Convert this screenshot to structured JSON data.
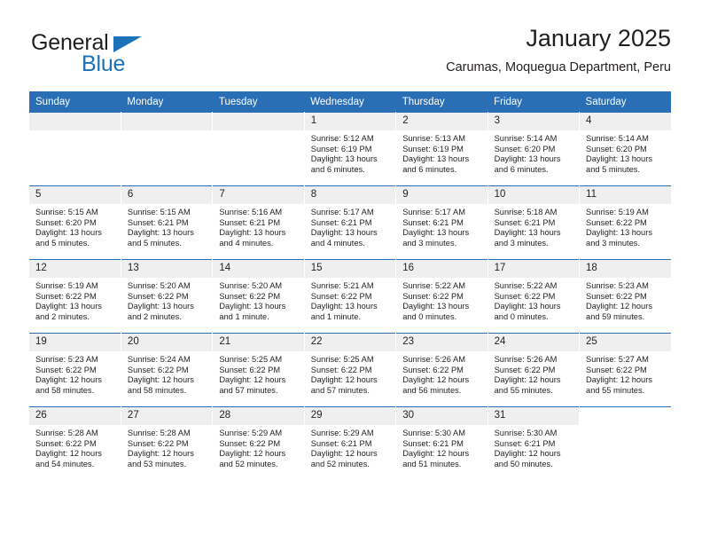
{
  "brand": {
    "name_top": "General",
    "name_bottom": "Blue",
    "accent_color": "#1b72b8"
  },
  "header": {
    "title": "January 2025",
    "subtitle": "Carumas, Moquegua Department, Peru"
  },
  "calendar": {
    "header_bg": "#2a6eb5",
    "daynum_bg": "#efefef",
    "weekdays": [
      "Sunday",
      "Monday",
      "Tuesday",
      "Wednesday",
      "Thursday",
      "Friday",
      "Saturday"
    ],
    "labels": {
      "sunrise": "Sunrise:",
      "sunset": "Sunset:",
      "daylight": "Daylight:"
    },
    "weeks": [
      [
        {
          "day": "",
          "empty": true
        },
        {
          "day": "",
          "empty": true
        },
        {
          "day": "",
          "empty": true
        },
        {
          "day": "1",
          "sunrise": "Sunrise: 5:12 AM",
          "sunset": "Sunset: 6:19 PM",
          "daylight1": "Daylight: 13 hours",
          "daylight2": "and 6 minutes."
        },
        {
          "day": "2",
          "sunrise": "Sunrise: 5:13 AM",
          "sunset": "Sunset: 6:19 PM",
          "daylight1": "Daylight: 13 hours",
          "daylight2": "and 6 minutes."
        },
        {
          "day": "3",
          "sunrise": "Sunrise: 5:14 AM",
          "sunset": "Sunset: 6:20 PM",
          "daylight1": "Daylight: 13 hours",
          "daylight2": "and 6 minutes."
        },
        {
          "day": "4",
          "sunrise": "Sunrise: 5:14 AM",
          "sunset": "Sunset: 6:20 PM",
          "daylight1": "Daylight: 13 hours",
          "daylight2": "and 5 minutes."
        }
      ],
      [
        {
          "day": "5",
          "sunrise": "Sunrise: 5:15 AM",
          "sunset": "Sunset: 6:20 PM",
          "daylight1": "Daylight: 13 hours",
          "daylight2": "and 5 minutes."
        },
        {
          "day": "6",
          "sunrise": "Sunrise: 5:15 AM",
          "sunset": "Sunset: 6:21 PM",
          "daylight1": "Daylight: 13 hours",
          "daylight2": "and 5 minutes."
        },
        {
          "day": "7",
          "sunrise": "Sunrise: 5:16 AM",
          "sunset": "Sunset: 6:21 PM",
          "daylight1": "Daylight: 13 hours",
          "daylight2": "and 4 minutes."
        },
        {
          "day": "8",
          "sunrise": "Sunrise: 5:17 AM",
          "sunset": "Sunset: 6:21 PM",
          "daylight1": "Daylight: 13 hours",
          "daylight2": "and 4 minutes."
        },
        {
          "day": "9",
          "sunrise": "Sunrise: 5:17 AM",
          "sunset": "Sunset: 6:21 PM",
          "daylight1": "Daylight: 13 hours",
          "daylight2": "and 3 minutes."
        },
        {
          "day": "10",
          "sunrise": "Sunrise: 5:18 AM",
          "sunset": "Sunset: 6:21 PM",
          "daylight1": "Daylight: 13 hours",
          "daylight2": "and 3 minutes."
        },
        {
          "day": "11",
          "sunrise": "Sunrise: 5:19 AM",
          "sunset": "Sunset: 6:22 PM",
          "daylight1": "Daylight: 13 hours",
          "daylight2": "and 3 minutes."
        }
      ],
      [
        {
          "day": "12",
          "sunrise": "Sunrise: 5:19 AM",
          "sunset": "Sunset: 6:22 PM",
          "daylight1": "Daylight: 13 hours",
          "daylight2": "and 2 minutes."
        },
        {
          "day": "13",
          "sunrise": "Sunrise: 5:20 AM",
          "sunset": "Sunset: 6:22 PM",
          "daylight1": "Daylight: 13 hours",
          "daylight2": "and 2 minutes."
        },
        {
          "day": "14",
          "sunrise": "Sunrise: 5:20 AM",
          "sunset": "Sunset: 6:22 PM",
          "daylight1": "Daylight: 13 hours",
          "daylight2": "and 1 minute."
        },
        {
          "day": "15",
          "sunrise": "Sunrise: 5:21 AM",
          "sunset": "Sunset: 6:22 PM",
          "daylight1": "Daylight: 13 hours",
          "daylight2": "and 1 minute."
        },
        {
          "day": "16",
          "sunrise": "Sunrise: 5:22 AM",
          "sunset": "Sunset: 6:22 PM",
          "daylight1": "Daylight: 13 hours",
          "daylight2": "and 0 minutes."
        },
        {
          "day": "17",
          "sunrise": "Sunrise: 5:22 AM",
          "sunset": "Sunset: 6:22 PM",
          "daylight1": "Daylight: 13 hours",
          "daylight2": "and 0 minutes."
        },
        {
          "day": "18",
          "sunrise": "Sunrise: 5:23 AM",
          "sunset": "Sunset: 6:22 PM",
          "daylight1": "Daylight: 12 hours",
          "daylight2": "and 59 minutes."
        }
      ],
      [
        {
          "day": "19",
          "sunrise": "Sunrise: 5:23 AM",
          "sunset": "Sunset: 6:22 PM",
          "daylight1": "Daylight: 12 hours",
          "daylight2": "and 58 minutes."
        },
        {
          "day": "20",
          "sunrise": "Sunrise: 5:24 AM",
          "sunset": "Sunset: 6:22 PM",
          "daylight1": "Daylight: 12 hours",
          "daylight2": "and 58 minutes."
        },
        {
          "day": "21",
          "sunrise": "Sunrise: 5:25 AM",
          "sunset": "Sunset: 6:22 PM",
          "daylight1": "Daylight: 12 hours",
          "daylight2": "and 57 minutes."
        },
        {
          "day": "22",
          "sunrise": "Sunrise: 5:25 AM",
          "sunset": "Sunset: 6:22 PM",
          "daylight1": "Daylight: 12 hours",
          "daylight2": "and 57 minutes."
        },
        {
          "day": "23",
          "sunrise": "Sunrise: 5:26 AM",
          "sunset": "Sunset: 6:22 PM",
          "daylight1": "Daylight: 12 hours",
          "daylight2": "and 56 minutes."
        },
        {
          "day": "24",
          "sunrise": "Sunrise: 5:26 AM",
          "sunset": "Sunset: 6:22 PM",
          "daylight1": "Daylight: 12 hours",
          "daylight2": "and 55 minutes."
        },
        {
          "day": "25",
          "sunrise": "Sunrise: 5:27 AM",
          "sunset": "Sunset: 6:22 PM",
          "daylight1": "Daylight: 12 hours",
          "daylight2": "and 55 minutes."
        }
      ],
      [
        {
          "day": "26",
          "sunrise": "Sunrise: 5:28 AM",
          "sunset": "Sunset: 6:22 PM",
          "daylight1": "Daylight: 12 hours",
          "daylight2": "and 54 minutes."
        },
        {
          "day": "27",
          "sunrise": "Sunrise: 5:28 AM",
          "sunset": "Sunset: 6:22 PM",
          "daylight1": "Daylight: 12 hours",
          "daylight2": "and 53 minutes."
        },
        {
          "day": "28",
          "sunrise": "Sunrise: 5:29 AM",
          "sunset": "Sunset: 6:22 PM",
          "daylight1": "Daylight: 12 hours",
          "daylight2": "and 52 minutes."
        },
        {
          "day": "29",
          "sunrise": "Sunrise: 5:29 AM",
          "sunset": "Sunset: 6:21 PM",
          "daylight1": "Daylight: 12 hours",
          "daylight2": "and 52 minutes."
        },
        {
          "day": "30",
          "sunrise": "Sunrise: 5:30 AM",
          "sunset": "Sunset: 6:21 PM",
          "daylight1": "Daylight: 12 hours",
          "daylight2": "and 51 minutes."
        },
        {
          "day": "31",
          "sunrise": "Sunrise: 5:30 AM",
          "sunset": "Sunset: 6:21 PM",
          "daylight1": "Daylight: 12 hours",
          "daylight2": "and 50 minutes."
        },
        {
          "day": "",
          "empty": true,
          "blank": true
        }
      ]
    ]
  }
}
